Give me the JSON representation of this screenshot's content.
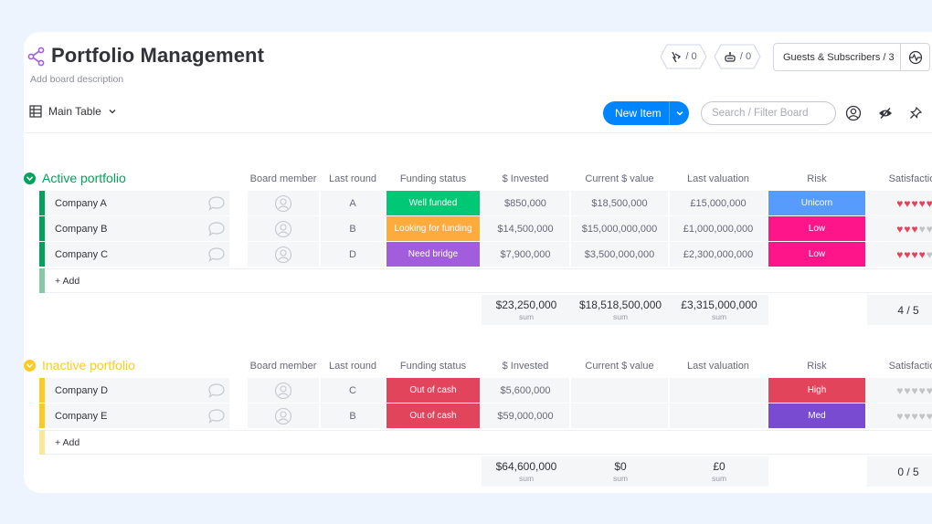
{
  "board": {
    "title": "Portfolio Management",
    "description": "Add board description",
    "view_label": "Main Table"
  },
  "header_actions": {
    "activity_count": "/ 0",
    "integrations_count": "/ 0",
    "guests_label": "Guests & Subscribers / 3"
  },
  "toolbar": {
    "new_item_label": "New Item",
    "search_placeholder": "Search / Filter Board"
  },
  "columns": [
    "Board member",
    "Last round",
    "Funding status",
    "$ Invested",
    "Current $ value",
    "Last valuation",
    "Risk",
    "Satisfaction"
  ],
  "add_label": "+ Add",
  "sum_label": "sum",
  "colors": {
    "active_group": "#00a359",
    "inactive_group": "#fdca24",
    "well_funded": "#00c875",
    "looking_for_funding": "#fdab3d",
    "need_bridge": "#a25ddc",
    "out_of_cash": "#e2445c",
    "unicorn": "#579bfc",
    "low": "#ff158a",
    "high": "#e2445c",
    "med": "#784bd1",
    "primary": "#0085ff"
  },
  "groups": [
    {
      "title": "Active portfolio",
      "rows": [
        {
          "name": "Company A",
          "last_round": "A",
          "funding_status": "Well funded",
          "invested": "$850,000",
          "current_value": "$18,500,000",
          "last_valuation": "£15,000,000",
          "risk": "Unicorn",
          "satisfaction": 5
        },
        {
          "name": "Company B",
          "last_round": "B",
          "funding_status": "Looking for funding",
          "invested": "$14,500,000",
          "current_value": "$15,000,000,000",
          "last_valuation": "£1,000,000,000",
          "risk": "Low",
          "satisfaction": 3
        },
        {
          "name": "Company C",
          "last_round": "D",
          "funding_status": "Need bridge",
          "invested": "$7,900,000",
          "current_value": "$3,500,000,000",
          "last_valuation": "£2,300,000,000",
          "risk": "Low",
          "satisfaction": 4
        }
      ],
      "totals": {
        "invested": "$23,250,000",
        "current_value": "$18,518,500,000",
        "last_valuation": "£3,315,000,000",
        "satisfaction": "4 / 5"
      }
    },
    {
      "title": "Inactive portfolio",
      "rows": [
        {
          "name": "Company D",
          "last_round": "C",
          "funding_status": "Out of cash",
          "invested": "$5,600,000",
          "current_value": "",
          "last_valuation": "",
          "risk": "High",
          "satisfaction": 0
        },
        {
          "name": "Company E",
          "last_round": "B",
          "funding_status": "Out of cash",
          "invested": "$59,000,000",
          "current_value": "",
          "last_valuation": "",
          "risk": "Med",
          "satisfaction": 0
        }
      ],
      "totals": {
        "invested": "$64,600,000",
        "current_value": "$0",
        "last_valuation": "£0",
        "satisfaction": "0 / 5"
      }
    }
  ]
}
